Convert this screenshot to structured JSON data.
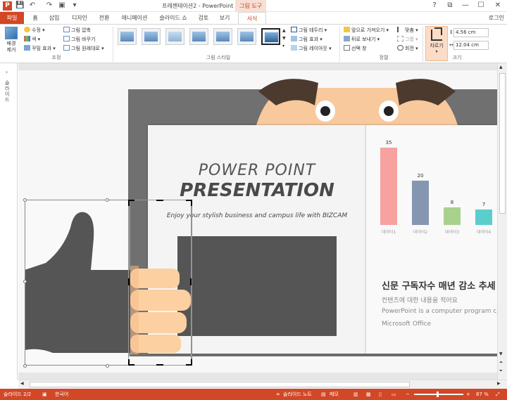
{
  "window": {
    "title": "프레젠테이션2 - PowerPoint",
    "context_tab_group": "그림 도구",
    "app_icon": "P",
    "controls": [
      "?",
      "⧉",
      "—",
      "☐",
      "✕"
    ]
  },
  "tabs": [
    {
      "label": "파일"
    },
    {
      "label": "홈"
    },
    {
      "label": "삽입"
    },
    {
      "label": "디자인"
    },
    {
      "label": "전환"
    },
    {
      "label": "애니메이션"
    },
    {
      "label": "슬라이드 쇼"
    },
    {
      "label": "검토"
    },
    {
      "label": "보기"
    },
    {
      "label": "서식"
    }
  ],
  "login": "로그인",
  "ribbon": {
    "adjust": {
      "remove_bg": "배경\n제거",
      "correct": "수정",
      "color": "색",
      "artistic": "꾸밈 효과",
      "compress": "그림 압축",
      "change": "그림 바꾸기",
      "reset": "그림 원래대로",
      "group_label": "조정"
    },
    "styles": {
      "group_label": "그림 스타일",
      "border": "그림 테두리",
      "effects": "그림 효과",
      "layout": "그림 레이아웃"
    },
    "arrange": {
      "bring_forward": "앞으로 가져오기",
      "send_backward": "뒤로 보내기",
      "selection_pane": "선택 창",
      "align": "맞춤",
      "group": "그룹",
      "rotate": "회전",
      "group_label": "정렬"
    },
    "size": {
      "crop": "자르기",
      "height": "4.56 cm",
      "width": "12.04 cm",
      "group_label": "크기"
    }
  },
  "side_panel": {
    "label": "슬라이드"
  },
  "slide": {
    "title_line1": "POWER POINT",
    "title_line2": "PRESENTATION",
    "subtitle": "Enjoy your stylish business and campus life with BIZCAM",
    "right_title": "신문 구독자수 매년 감소 추세",
    "right_text1": "컨텐츠에 대한 내용을 적어요",
    "right_text2": "PowerPoint is a computer program created",
    "right_text3": "Microsoft Office"
  },
  "chart_data": {
    "type": "bar",
    "categories": [
      "데이터1",
      "데이터2",
      "데이터3",
      "데이터4"
    ],
    "values": [
      35,
      20,
      8,
      7
    ],
    "colors": [
      "#f7a1a1",
      "#8496b0",
      "#a9d18e",
      "#5ccdcd"
    ],
    "ylim": [
      0,
      35
    ]
  },
  "status": {
    "slide_info": "슬라이드 2/2",
    "language": "한국어",
    "notes": "슬라이드 노트",
    "comments": "메모",
    "zoom": "87 %"
  }
}
